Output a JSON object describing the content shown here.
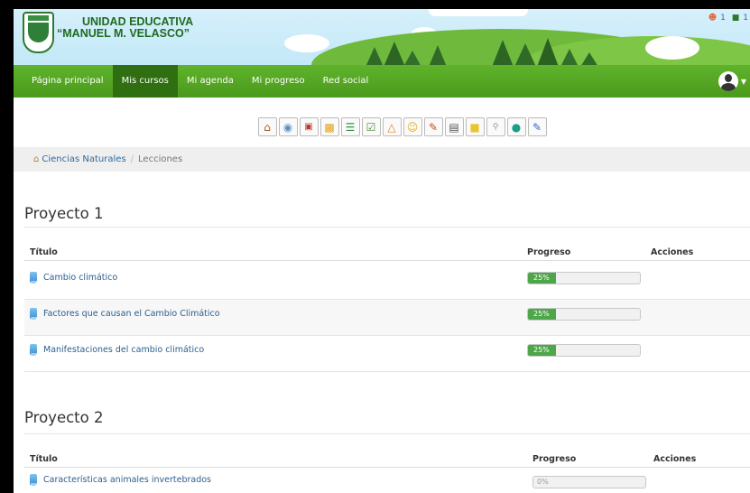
{
  "header": {
    "school_line1": "UNIDAD EDUCATIVA",
    "school_line2": "“MANUEL M. VELASCO”",
    "notifications_count": "1",
    "messages_count": "1"
  },
  "nav": {
    "items": [
      "Página principal",
      "Mis cursos",
      "Mi agenda",
      "Mi progreso",
      "Red social"
    ],
    "active": "Mis cursos"
  },
  "toolbar": {
    "icons": [
      "home-icon",
      "course-description-icon",
      "calendar-icon",
      "documents-icon",
      "learning-path-icon",
      "exercises-icon",
      "announcements-icon",
      "forum-icon",
      "wiki-icon",
      "gradebook-icon",
      "notebook-icon",
      "search-icon",
      "chat-icon",
      "assignments-icon"
    ]
  },
  "breadcrumb": {
    "course": "Ciencias Naturales",
    "current": "Lecciones"
  },
  "sections": [
    {
      "title": "Proyecto 1",
      "headers": {
        "title": "Título",
        "progress": "Progreso",
        "actions": "Acciones"
      },
      "rows": [
        {
          "title": "Cambio climático",
          "progress": 25,
          "progress_label": "25%"
        },
        {
          "title": "Factores que causan el Cambio Climático",
          "progress": 25,
          "progress_label": "25%"
        },
        {
          "title": "Manifestaciones del cambio climático",
          "progress": 25,
          "progress_label": "25%"
        }
      ]
    },
    {
      "title": "Proyecto 2",
      "headers": {
        "title": "Título",
        "progress": "Progreso",
        "actions": "Acciones"
      },
      "rows": [
        {
          "title": "Características animales invertebrados",
          "progress": 0,
          "progress_label": "0%"
        }
      ]
    }
  ]
}
